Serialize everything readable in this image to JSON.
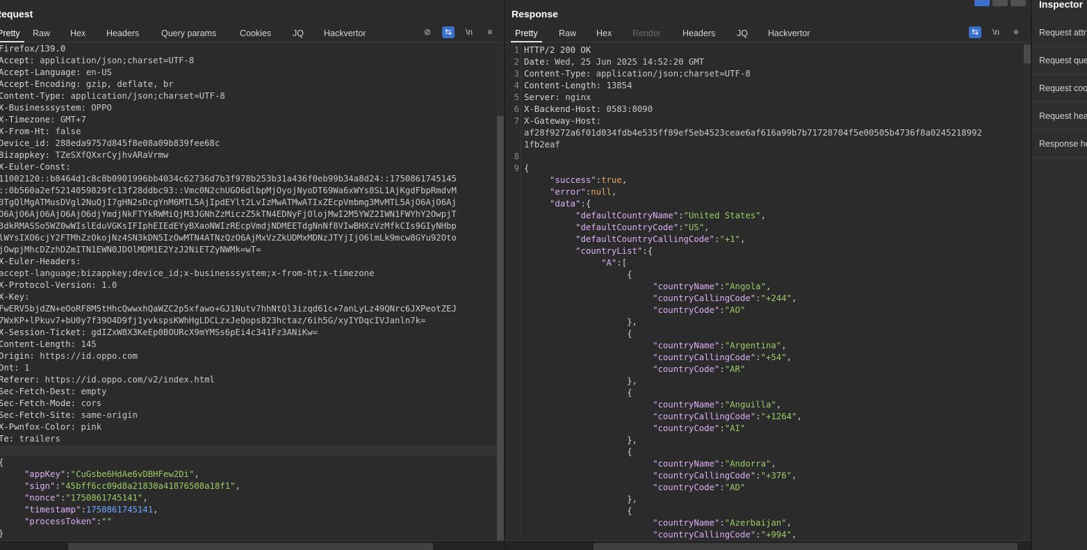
{
  "request": {
    "title": "Request",
    "tabs": [
      "Pretty",
      "Raw",
      "Hex",
      "Headers",
      "Query params",
      "Cookies",
      "JQ",
      "Hackvertor"
    ],
    "active_tab": "Pretty",
    "header_lines": [
      {
        "k": "Firefox/139.0",
        "v": ""
      },
      {
        "k": "Accept:",
        "v": " application/json;charset=UTF-8"
      },
      {
        "k": "Accept-Language:",
        "v": " en-US"
      },
      {
        "k": "Accept-Encoding:",
        "v": " gzip, deflate, br"
      },
      {
        "k": "Content-Type:",
        "v": " application/json;charset=UTF-8"
      },
      {
        "k": "X-Businesssystem:",
        "v": " OPPO"
      },
      {
        "k": "X-Timezone:",
        "v": " GMT+7"
      },
      {
        "k": "X-From-Ht:",
        "v": " false"
      },
      {
        "k": "Device_id:",
        "v": " 288eda9757d845f8e08a09b839fee68c"
      },
      {
        "k": "Bizappkey:",
        "v": " TZeSXfQXxrCyjhvARaVrmw"
      },
      {
        "k": "X-Euler-Const:",
        "v": ""
      },
      {
        "k": "",
        "v": "11002120::b8464d1c8c8b0901996bb4034c62736d7b3f978b253b31a436f0eb99b34a8d24::1750861745145"
      },
      {
        "k": "",
        "v": "::0b560a2ef5214059829fc13f28ddbc93::Vmc0N2chUGO6dlbpMjOyojNyoDT69Wa6xWYs8SL1AjKgdFbpRmdvM"
      },
      {
        "k": "",
        "v": "3TgQlMgATMusDVgl2NuQjI7gHN2sDcgYnM6MTL5AjIpdEYlt2LvIzMwATMwATIxZEcpVmbmg3MvMTL5AjO6AjO6Aj"
      },
      {
        "k": "",
        "v": "O6AjO6AjO6AjO6AjO6djYmdjNkFTYkRWMiQjM3JGNhZzMiczZ5kTN4EDNyFjOlojMwI2M5YWZ2IWN1FWYhY2OwpjT"
      },
      {
        "k": "",
        "v": "3dkRMASSo5WZ0wWIslEduVGKsIFIphEIEdEYyBXaoNWIzREcpVmdjNDMEETdgNnNf8VIwBHXzVzMfkCIs9GIyNHbp"
      },
      {
        "k": "",
        "v": "lWYsIXO6cjY2FTMhZzOkojNz4SN3kDN5IzOwMTN4ATNzQzO6AjMxVzZkUDMxMDNzJTYjIjO6lmLk9mcw8GYu92Oto"
      },
      {
        "k": "",
        "v": "jOwpjMhcDZzhDZmITN1EWN0JDOlMDM1E2YzJ2NiETZyNWMk=wT="
      },
      {
        "k": "X-Euler-Headers:",
        "v": ""
      },
      {
        "k": "",
        "v": "accept-language;bizappkey;device_id;x-businesssystem;x-from-ht;x-timezone"
      },
      {
        "k": "X-Protocol-Version:",
        "v": " 1.0"
      },
      {
        "k": "X-Key:",
        "v": ""
      },
      {
        "k": "",
        "v": "FwERV5bjdZN+eOoRF8M5tHhcQwwxhQaWZC2p5xfawo+GJ1Nutv7hhNtQl3izqd61c+7anLyLz49QNrc6JXPeotZEJ"
      },
      {
        "k": "",
        "v": "7WxKP+lPkuv7+bU0y7f39O4D9fj1yvkspsKWhHgLDCLzxJeQops823hctaz/6ih5G/xyIYDqcIVJanln7k="
      },
      {
        "k": "X-Session-Ticket:",
        "v": " gdIZxW8X3KeEp0BOURcX9mYMSs6pEi4c341Fz3ANiKw="
      },
      {
        "k": "Content-Length:",
        "v": " 145"
      },
      {
        "k": "Origin:",
        "v": " https://id.oppo.com"
      },
      {
        "k": "Dnt:",
        "v": " 1"
      },
      {
        "k": "Referer:",
        "v": " https://id.oppo.com/v2/index.html"
      },
      {
        "k": "Sec-Fetch-Dest:",
        "v": " empty"
      },
      {
        "k": "Sec-Fetch-Mode:",
        "v": " cors"
      },
      {
        "k": "Sec-Fetch-Site:",
        "v": " same-origin"
      },
      {
        "k": "X-Pwnfox-Color:",
        "v": " pink"
      },
      {
        "k": "Te:",
        "v": " trailers"
      }
    ],
    "body_lines": [
      [
        {
          "t": "{",
          "c": "jp"
        }
      ],
      [
        {
          "t": "     ",
          "c": "jp"
        },
        {
          "t": "\"appKey\"",
          "c": "jk"
        },
        {
          "t": ":",
          "c": "jp"
        },
        {
          "t": "\"CuGsbe6HdAe6vDBHFew2Di\"",
          "c": "jsv"
        },
        {
          "t": ",",
          "c": "jp"
        }
      ],
      [
        {
          "t": "     ",
          "c": "jp"
        },
        {
          "t": "\"sign\"",
          "c": "jk"
        },
        {
          "t": ":",
          "c": "jp"
        },
        {
          "t": "\"45bff6cc09d8a21830a41876508a18f1\"",
          "c": "jsv"
        },
        {
          "t": ",",
          "c": "jp"
        }
      ],
      [
        {
          "t": "     ",
          "c": "jp"
        },
        {
          "t": "\"nonce\"",
          "c": "jk"
        },
        {
          "t": ":",
          "c": "jp"
        },
        {
          "t": "\"1750861745141\"",
          "c": "jsv"
        },
        {
          "t": ",",
          "c": "jp"
        }
      ],
      [
        {
          "t": "     ",
          "c": "jp"
        },
        {
          "t": "\"timestamp\"",
          "c": "jk"
        },
        {
          "t": ":",
          "c": "jp"
        },
        {
          "t": "1750861745141",
          "c": "jn"
        },
        {
          "t": ",",
          "c": "jp"
        }
      ],
      [
        {
          "t": "     ",
          "c": "jp"
        },
        {
          "t": "\"processToken\"",
          "c": "jk"
        },
        {
          "t": ":",
          "c": "jp"
        },
        {
          "t": "\"\"",
          "c": "jsv"
        }
      ],
      [
        {
          "t": "}",
          "c": "jp"
        }
      ]
    ]
  },
  "response": {
    "title": "Response",
    "tabs": [
      "Pretty",
      "Raw",
      "Hex",
      "Render",
      "Headers",
      "JQ",
      "Hackvertor"
    ],
    "active_tab": "Pretty",
    "disabled_tab": "Render",
    "line_numbers": [
      "1",
      "2",
      "3",
      "4",
      "5",
      "6",
      "7",
      "8",
      "9"
    ],
    "lines": [
      [
        {
          "t": "HTTP/2 200 OK",
          "c": "k"
        }
      ],
      [
        {
          "t": "Date:",
          "c": "k"
        },
        {
          "t": " Wed, 25 Jun 2025 14:52:20 GMT",
          "c": "v"
        }
      ],
      [
        {
          "t": "Content-Type:",
          "c": "k"
        },
        {
          "t": " application/json;charset=UTF-8",
          "c": "v"
        }
      ],
      [
        {
          "t": "Content-Length:",
          "c": "k"
        },
        {
          "t": " 13854",
          "c": "v"
        }
      ],
      [
        {
          "t": "Server:",
          "c": "k"
        },
        {
          "t": " nginx",
          "c": "v"
        }
      ],
      [
        {
          "t": "X-Backend-Host:",
          "c": "k"
        },
        {
          "t": " 0583:8090",
          "c": "v"
        }
      ],
      [
        {
          "t": "X-Gateway-Host:",
          "c": "k"
        }
      ],
      [
        {
          "t": "af28f9272a6f01d034fdb4e535ff89ef5eb4523ceae6af616a99b7b71728704f5e00505b4736f8a0245218992",
          "c": "v"
        }
      ],
      [
        {
          "t": "1fb2eaf",
          "c": "v"
        }
      ],
      [
        {
          "t": "",
          "c": "jp"
        }
      ],
      [
        {
          "t": "{",
          "c": "jp"
        }
      ],
      [
        {
          "t": "     ",
          "c": "jp"
        },
        {
          "t": "\"success\"",
          "c": "jk"
        },
        {
          "t": ":",
          "c": "jp"
        },
        {
          "t": "true",
          "c": "jb"
        },
        {
          "t": ",",
          "c": "jp"
        }
      ],
      [
        {
          "t": "     ",
          "c": "jp"
        },
        {
          "t": "\"error\"",
          "c": "jk"
        },
        {
          "t": ":",
          "c": "jp"
        },
        {
          "t": "null",
          "c": "jb"
        },
        {
          "t": ",",
          "c": "jp"
        }
      ],
      [
        {
          "t": "     ",
          "c": "jp"
        },
        {
          "t": "\"data\"",
          "c": "jk"
        },
        {
          "t": ":{",
          "c": "jp"
        }
      ],
      [
        {
          "t": "          ",
          "c": "jp"
        },
        {
          "t": "\"defaultCountryName\"",
          "c": "jk"
        },
        {
          "t": ":",
          "c": "jp"
        },
        {
          "t": "\"United States\"",
          "c": "jsv"
        },
        {
          "t": ",",
          "c": "jp"
        }
      ],
      [
        {
          "t": "          ",
          "c": "jp"
        },
        {
          "t": "\"defaultCountryCode\"",
          "c": "jk"
        },
        {
          "t": ":",
          "c": "jp"
        },
        {
          "t": "\"US\"",
          "c": "jsv"
        },
        {
          "t": ",",
          "c": "jp"
        }
      ],
      [
        {
          "t": "          ",
          "c": "jp"
        },
        {
          "t": "\"defaultCountryCallingCode\"",
          "c": "jk"
        },
        {
          "t": ":",
          "c": "jp"
        },
        {
          "t": "\"+1\"",
          "c": "jsv"
        },
        {
          "t": ",",
          "c": "jp"
        }
      ],
      [
        {
          "t": "          ",
          "c": "jp"
        },
        {
          "t": "\"countryList\"",
          "c": "jk"
        },
        {
          "t": ":{",
          "c": "jp"
        }
      ],
      [
        {
          "t": "               ",
          "c": "jp"
        },
        {
          "t": "\"A\"",
          "c": "jk"
        },
        {
          "t": ":[",
          "c": "jp"
        }
      ],
      [
        {
          "t": "                    {",
          "c": "jp"
        }
      ],
      [
        {
          "t": "                         ",
          "c": "jp"
        },
        {
          "t": "\"countryName\"",
          "c": "jk"
        },
        {
          "t": ":",
          "c": "jp"
        },
        {
          "t": "\"Angola\"",
          "c": "jsv"
        },
        {
          "t": ",",
          "c": "jp"
        }
      ],
      [
        {
          "t": "                         ",
          "c": "jp"
        },
        {
          "t": "\"countryCallingCode\"",
          "c": "jk"
        },
        {
          "t": ":",
          "c": "jp"
        },
        {
          "t": "\"+244\"",
          "c": "jsv"
        },
        {
          "t": ",",
          "c": "jp"
        }
      ],
      [
        {
          "t": "                         ",
          "c": "jp"
        },
        {
          "t": "\"countryCode\"",
          "c": "jk"
        },
        {
          "t": ":",
          "c": "jp"
        },
        {
          "t": "\"AO\"",
          "c": "jsv"
        }
      ],
      [
        {
          "t": "                    },",
          "c": "jp"
        }
      ],
      [
        {
          "t": "                    {",
          "c": "jp"
        }
      ],
      [
        {
          "t": "                         ",
          "c": "jp"
        },
        {
          "t": "\"countryName\"",
          "c": "jk"
        },
        {
          "t": ":",
          "c": "jp"
        },
        {
          "t": "\"Argentina\"",
          "c": "jsv"
        },
        {
          "t": ",",
          "c": "jp"
        }
      ],
      [
        {
          "t": "                         ",
          "c": "jp"
        },
        {
          "t": "\"countryCallingCode\"",
          "c": "jk"
        },
        {
          "t": ":",
          "c": "jp"
        },
        {
          "t": "\"+54\"",
          "c": "jsv"
        },
        {
          "t": ",",
          "c": "jp"
        }
      ],
      [
        {
          "t": "                         ",
          "c": "jp"
        },
        {
          "t": "\"countryCode\"",
          "c": "jk"
        },
        {
          "t": ":",
          "c": "jp"
        },
        {
          "t": "\"AR\"",
          "c": "jsv"
        }
      ],
      [
        {
          "t": "                    },",
          "c": "jp"
        }
      ],
      [
        {
          "t": "                    {",
          "c": "jp"
        }
      ],
      [
        {
          "t": "                         ",
          "c": "jp"
        },
        {
          "t": "\"countryName\"",
          "c": "jk"
        },
        {
          "t": ":",
          "c": "jp"
        },
        {
          "t": "\"Anguilla\"",
          "c": "jsv"
        },
        {
          "t": ",",
          "c": "jp"
        }
      ],
      [
        {
          "t": "                         ",
          "c": "jp"
        },
        {
          "t": "\"countryCallingCode\"",
          "c": "jk"
        },
        {
          "t": ":",
          "c": "jp"
        },
        {
          "t": "\"+1264\"",
          "c": "jsv"
        },
        {
          "t": ",",
          "c": "jp"
        }
      ],
      [
        {
          "t": "                         ",
          "c": "jp"
        },
        {
          "t": "\"countryCode\"",
          "c": "jk"
        },
        {
          "t": ":",
          "c": "jp"
        },
        {
          "t": "\"AI\"",
          "c": "jsv"
        }
      ],
      [
        {
          "t": "                    },",
          "c": "jp"
        }
      ],
      [
        {
          "t": "                    {",
          "c": "jp"
        }
      ],
      [
        {
          "t": "                         ",
          "c": "jp"
        },
        {
          "t": "\"countryName\"",
          "c": "jk"
        },
        {
          "t": ":",
          "c": "jp"
        },
        {
          "t": "\"Andorra\"",
          "c": "jsv"
        },
        {
          "t": ",",
          "c": "jp"
        }
      ],
      [
        {
          "t": "                         ",
          "c": "jp"
        },
        {
          "t": "\"countryCallingCode\"",
          "c": "jk"
        },
        {
          "t": ":",
          "c": "jp"
        },
        {
          "t": "\"+376\"",
          "c": "jsv"
        },
        {
          "t": ",",
          "c": "jp"
        }
      ],
      [
        {
          "t": "                         ",
          "c": "jp"
        },
        {
          "t": "\"countryCode\"",
          "c": "jk"
        },
        {
          "t": ":",
          "c": "jp"
        },
        {
          "t": "\"AD\"",
          "c": "jsv"
        }
      ],
      [
        {
          "t": "                    },",
          "c": "jp"
        }
      ],
      [
        {
          "t": "                    {",
          "c": "jp"
        }
      ],
      [
        {
          "t": "                         ",
          "c": "jp"
        },
        {
          "t": "\"countryName\"",
          "c": "jk"
        },
        {
          "t": ":",
          "c": "jp"
        },
        {
          "t": "\"Azerbaijan\"",
          "c": "jsv"
        },
        {
          "t": ",",
          "c": "jp"
        }
      ],
      [
        {
          "t": "                         ",
          "c": "jp"
        },
        {
          "t": "\"countryCallingCode\"",
          "c": "jk"
        },
        {
          "t": ":",
          "c": "jp"
        },
        {
          "t": "\"+994\"",
          "c": "jsv"
        },
        {
          "t": ",",
          "c": "jp"
        }
      ]
    ]
  },
  "inspector": {
    "title": "Inspector",
    "items": [
      "Request attributes",
      "Request query parameters",
      "Request cookies",
      "Request headers",
      "Response headers"
    ]
  },
  "toolbar": {
    "newline_label": "\\n",
    "menu_label": "≡",
    "wrap_label": "⇆",
    "hide_label": "⊘"
  },
  "colors": {
    "accent": "#3a6fcc",
    "json_key": "#dcb0f5",
    "json_string": "#9ccc65",
    "json_number": "#6ea9ff",
    "json_literal": "#e8a76a"
  }
}
